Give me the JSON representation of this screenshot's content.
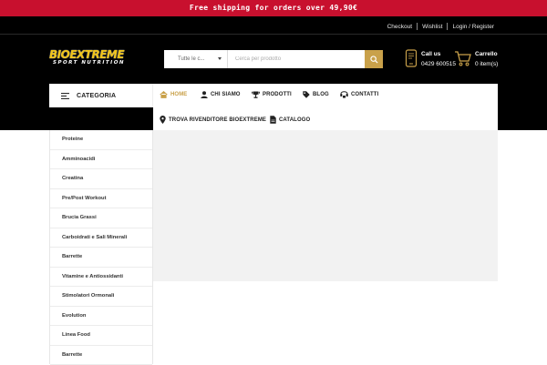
{
  "topbar": {
    "text": "Free shipping for orders over 49,90€"
  },
  "account": {
    "checkout": "Checkout",
    "wishlist": "Wishlist",
    "login": "Login / Register"
  },
  "logo": {
    "line1": "BIOEXTREME",
    "line2": "SPORT NUTRITION"
  },
  "search": {
    "category": "Tutte le c...",
    "placeholder": "Cerca per prodotto"
  },
  "call": {
    "label": "Call us",
    "number": "0429 600515"
  },
  "cart": {
    "label": "Carrello",
    "count": "0 item(s)"
  },
  "category_button": {
    "label": "CATEGORIA"
  },
  "menu": {
    "home": "HOME",
    "chi_siamo": "CHI SIAMO",
    "prodotti": "PRODOTTI",
    "blog": "BLOG",
    "contatti": "CONTATTI",
    "rivenditore": "TROVA RIVENDITORE BIOEXTREME",
    "catalogo": "CATALOGO"
  },
  "sidebar": {
    "items": [
      {
        "label": "Proteine"
      },
      {
        "label": "Amminoacidi"
      },
      {
        "label": "Creatina"
      },
      {
        "label": "Pre/Post Workout"
      },
      {
        "label": "Brucia Grassi"
      },
      {
        "label": "Carboidrati e Sali Minerali"
      },
      {
        "label": "Barrette"
      },
      {
        "label": "Vitamine e Antiossidanti"
      },
      {
        "label": "Stimolatori Ormonali"
      },
      {
        "label": "Evolution"
      },
      {
        "label": "Linea Food"
      },
      {
        "label": "Barrette"
      }
    ]
  },
  "colors": {
    "accent": "#c9a14a",
    "topbar": "#c8102e",
    "header": "#000000"
  },
  "icons": {
    "search": "search-icon",
    "phone": "phone-icon",
    "cart": "cart-icon",
    "menu": "hamburger-icon",
    "home": "home-icon",
    "user": "user-icon",
    "trophy": "trophy-icon",
    "tag": "tag-icon",
    "contact": "contact-icon",
    "pin": "map-pin-icon",
    "file": "file-icon"
  }
}
